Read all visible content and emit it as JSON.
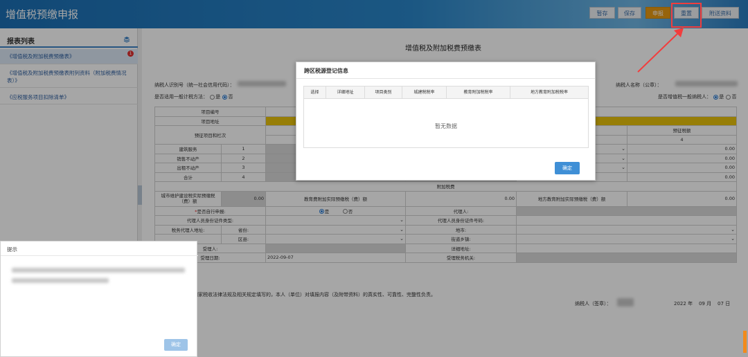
{
  "header": {
    "title": "增值税预缴申报",
    "buttons": [
      "暂存",
      "保存",
      "申报",
      "重置",
      "附送资料"
    ]
  },
  "sidebar": {
    "title": "报表列表",
    "items": [
      {
        "label": "《增值税及附加税费预缴表》",
        "badge": "1"
      },
      {
        "label": "《增值税及附加税费预缴表附列资料（附加税费情况表）》"
      },
      {
        "label": "《应税服务项目扣除清单》"
      }
    ]
  },
  "form": {
    "title": "增值税及附加税费预缴表",
    "taxpayer_id_label": "纳税人识别号（统一社会信用代码）：",
    "taxpayer_name_label": "纳税人名称（公章）：",
    "simple_method_label": "是否适用一般计税方法：",
    "general_taxpayer_label": "是否增值税一般纳税人：",
    "yes": "是",
    "no": "否",
    "rows": {
      "project_no": "项目编号",
      "project_addr": "项目地址",
      "prepay_item": "预征项目和栏次",
      "prepay_amount": "预征税额",
      "col4": "4",
      "construction": "建筑服务",
      "sale_realty": "销售不动产",
      "lease_realty": "出租不动产",
      "total": "合计",
      "r1": "1",
      "r2": "2",
      "r3": "3",
      "r4": "4",
      "zero": "0.00",
      "dash": "--"
    },
    "surcharge": {
      "title": "附加税费",
      "urban": "城市维护建设税实际预缴税（费）额",
      "edu": "教育费附加实际预缴税（费）额",
      "local_edu": "地方教育附加实际预缴税（费）额",
      "urban_val": "0.00",
      "edu_val": "0.00",
      "local_edu_val": "0.00"
    },
    "agent": {
      "self_declare": "是否自行申报:",
      "agent_person": "代理人:",
      "id_type": "代理人员身份证件类型:",
      "id_no": "代理人员身份证件号码:",
      "agent_addr": "税务代理人地址:",
      "province": "省份:",
      "city": "地市:",
      "district": "区县:",
      "street": "街道乡镇:",
      "receiver": "受理人:",
      "detail_addr": "详细地址:",
      "receive_date": "受理日期:",
      "date_val": "2022-09-07",
      "tax_office": "受理税务机关:"
    },
    "declaration": "声明：此表是根据国家税收法律法规及相关规定填写的，本人（单位）对填报内容（及附带资料）的真实性、可靠性、完整性负责。",
    "signature_label": "纳税人（签章）：",
    "year": "2022",
    "year_unit": "年",
    "month": "09",
    "month_unit": "月",
    "day": "07",
    "day_unit": "日"
  },
  "modal": {
    "title": "跨区税源登记信息",
    "columns": [
      "选择",
      "详细地址",
      "项目类别",
      "城建税税率",
      "教育附加税税率",
      "地方教育附加税税率"
    ],
    "empty": "暂无数据",
    "ok": "确定"
  },
  "tip": {
    "title": "提示",
    "ok": "确定"
  }
}
